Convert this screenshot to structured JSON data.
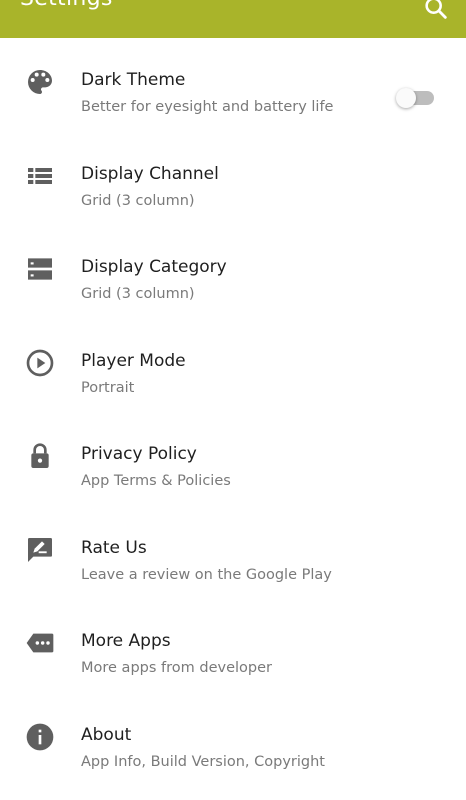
{
  "app_bar": {
    "title": "Settings",
    "background": "#a9b42a",
    "search_icon": "search-icon"
  },
  "items": [
    {
      "icon": "palette-icon",
      "title": "Dark Theme",
      "subtitle": "Better for eyesight and battery life",
      "toggle": {
        "on": false
      }
    },
    {
      "icon": "view-list-icon",
      "title": "Display Channel",
      "subtitle": "Grid (3 column)"
    },
    {
      "icon": "storage-icon",
      "title": "Display Category",
      "subtitle": "Grid (3 column)"
    },
    {
      "icon": "play-circle-icon",
      "title": "Player Mode",
      "subtitle": "Portrait"
    },
    {
      "icon": "lock-icon",
      "title": "Privacy Policy",
      "subtitle": "App Terms & Policies"
    },
    {
      "icon": "rate-review-icon",
      "title": "Rate Us",
      "subtitle": "Leave a review on the Google Play"
    },
    {
      "icon": "more-tag-icon",
      "title": "More Apps",
      "subtitle": "More apps from developer"
    },
    {
      "icon": "info-icon",
      "title": "About",
      "subtitle": "App Info, Build Version, Copyright"
    }
  ]
}
